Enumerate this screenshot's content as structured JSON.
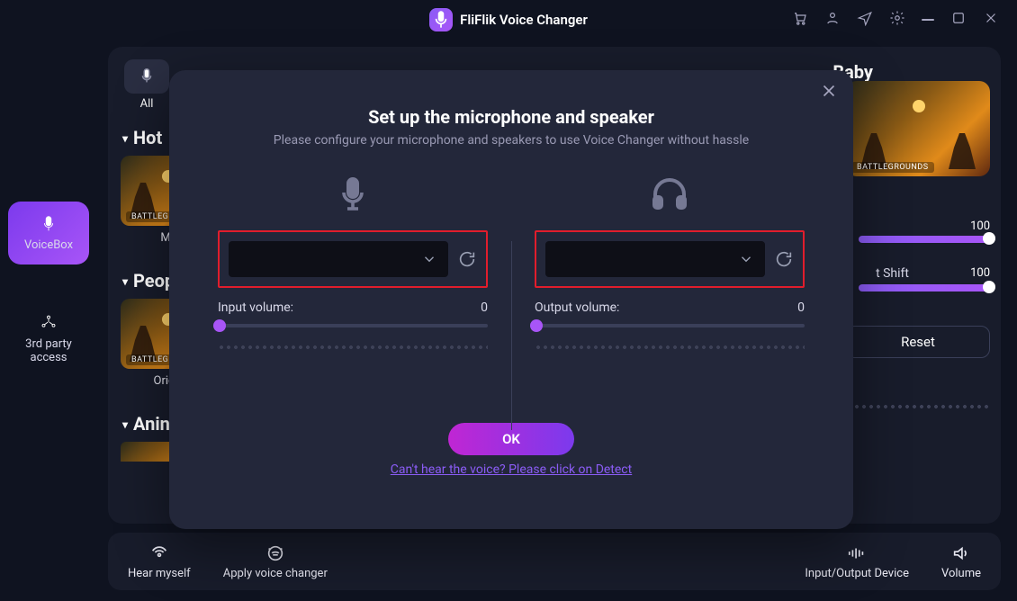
{
  "app": {
    "title": "FliFlik Voice Changer"
  },
  "left_rail": {
    "voicebox": "VoiceBox",
    "third_party": "3rd party access"
  },
  "tabs": {
    "all": "All"
  },
  "sections": {
    "hot": "Hot",
    "people": "Peop",
    "animation": "Anin"
  },
  "cards": {
    "hot_first": "M",
    "people_first": "Origi",
    "thumb_tag": "BATTLEGROUNDS"
  },
  "right_panel": {
    "title": "Baby",
    "slider1_value": "100",
    "shift_label": "t Shift",
    "slider2_value": "100",
    "reset": "Reset"
  },
  "bottombar": {
    "hear_myself": "Hear myself",
    "apply_voice_changer": "Apply voice changer",
    "input_output": "Input/Output Device",
    "volume": "Volume"
  },
  "modal": {
    "title": "Set up the microphone and speaker",
    "subtitle": "Please configure your microphone and speakers to use Voice Changer without hassle",
    "input_volume_label": "Input volume:",
    "input_volume_value": "0",
    "output_volume_label": "Output volume:",
    "output_volume_value": "0",
    "ok": "OK",
    "detect_link": "Can't hear the voice? Please click on Detect"
  }
}
